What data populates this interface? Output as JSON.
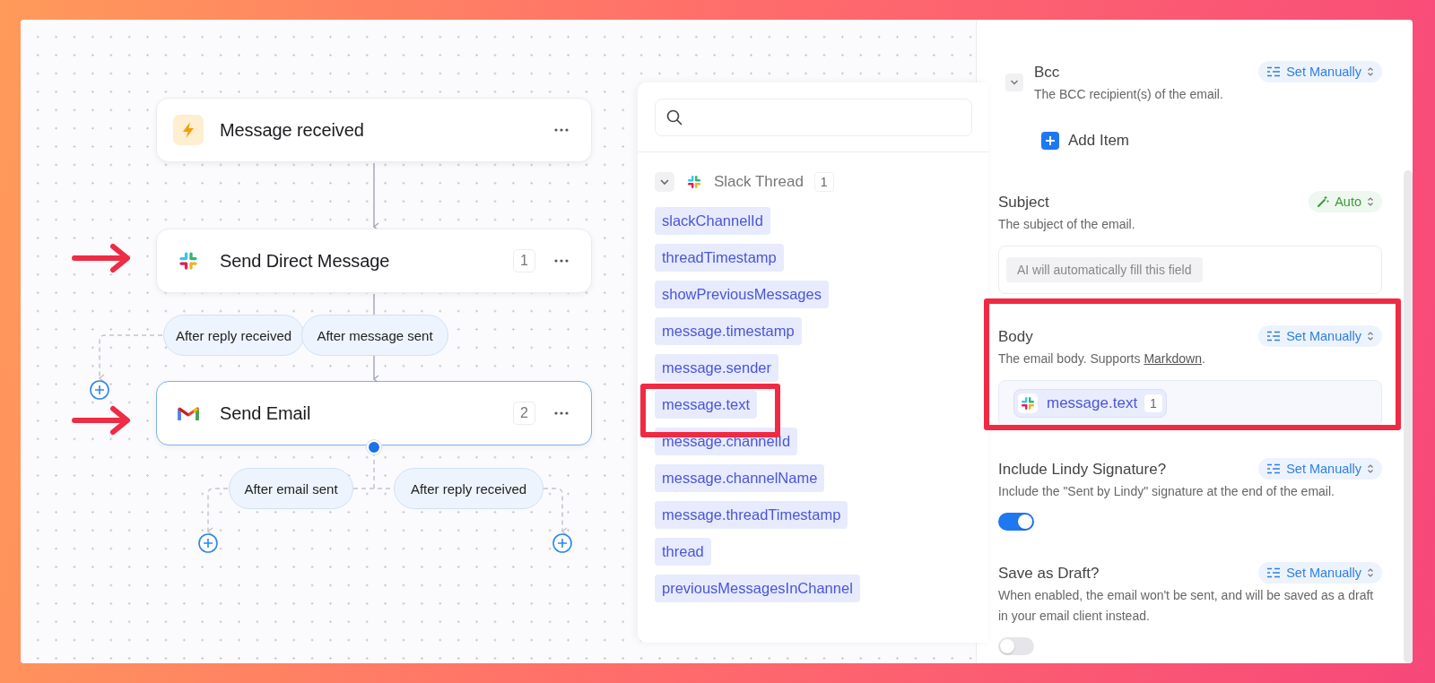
{
  "canvas": {
    "nodes": [
      {
        "kind": "trigger",
        "title": "Message received",
        "selected": false
      },
      {
        "kind": "slack",
        "title": "Send Direct Message",
        "count": "1",
        "selected": false
      },
      {
        "kind": "gmail",
        "title": "Send Email",
        "count": "2",
        "selected": true
      }
    ],
    "branches": [
      {
        "label": "After reply received"
      },
      {
        "label": "After message sent"
      },
      {
        "label": "After email sent"
      },
      {
        "label": "After reply received"
      }
    ]
  },
  "variable_picker": {
    "group": {
      "title": "Slack Thread",
      "count": "1",
      "expanded": true
    },
    "variables": [
      {
        "label": "slackChannelId"
      },
      {
        "label": "threadTimestamp"
      },
      {
        "label": "showPreviousMessages"
      },
      {
        "label": "message.timestamp"
      },
      {
        "label": "message.sender"
      },
      {
        "label": "message.text"
      },
      {
        "label": "message.channelId"
      },
      {
        "label": "message.channelName"
      },
      {
        "label": "message.threadTimestamp"
      },
      {
        "label": "thread"
      },
      {
        "label": "previousMessagesInChannel"
      }
    ]
  },
  "settings": {
    "fields": [
      {
        "kind": "list",
        "label": "Bcc",
        "description": "The BCC recipient(s) of the email.",
        "mode": {
          "kind": "manual",
          "label": "Set Manually"
        },
        "expanded": true,
        "add_label": "Add Item"
      },
      {
        "kind": "text",
        "label": "Subject",
        "description": "The subject of the email.",
        "mode": {
          "kind": "auto",
          "label": "Auto"
        },
        "hint": "AI will automatically fill this field"
      },
      {
        "kind": "variable",
        "label": "Body",
        "description": "The email body. Supports ",
        "link": "Markdown",
        "description_after": ".",
        "mode": {
          "kind": "manual",
          "label": "Set Manually"
        },
        "value": {
          "label": "message.text",
          "count": "1"
        }
      },
      {
        "kind": "toggle",
        "label": "Include Lindy Signature?",
        "description": "Include the \"Sent by Lindy\" signature at the end of the email.",
        "mode": {
          "kind": "manual",
          "label": "Set Manually"
        },
        "on": true
      },
      {
        "kind": "toggle",
        "label": "Save as Draft?",
        "description": "When enabled, the email won't be sent, and will be saved as a draft in your email client instead.",
        "mode": {
          "kind": "manual",
          "label": "Set Manually"
        },
        "on": false
      }
    ]
  }
}
